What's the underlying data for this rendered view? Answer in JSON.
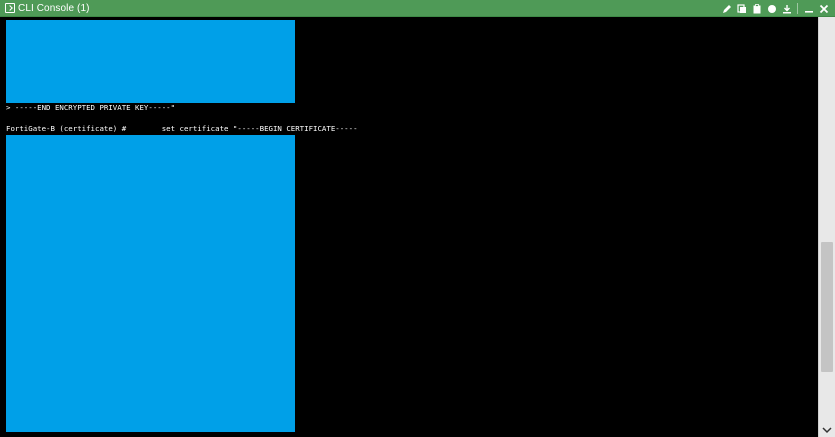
{
  "window": {
    "title": "CLI Console (1)",
    "actions": [
      {
        "name": "edit-icon"
      },
      {
        "name": "copy-icon"
      },
      {
        "name": "clipboard-icon"
      },
      {
        "name": "record-icon"
      },
      {
        "name": "download-icon"
      },
      {
        "name": "minimize-icon"
      },
      {
        "name": "close-icon"
      }
    ],
    "title_bar_color": "#4f9a57"
  },
  "terminal": {
    "background": "#000000",
    "redaction_color": "#00a0e8",
    "lines": [
      "> -----END ENCRYPTED PRIVATE KEY-----\"",
      "FortiGate-B (certificate) #        set certificate \"-----BEGIN CERTIFICATE-----"
    ]
  },
  "scrollbar": {
    "icon": "chevron-down-icon"
  }
}
